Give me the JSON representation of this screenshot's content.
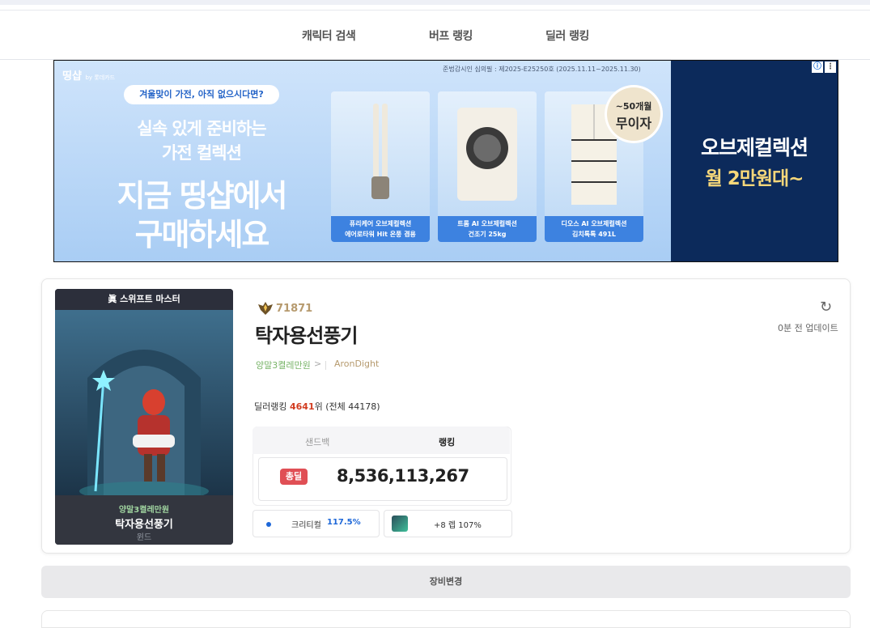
{
  "nav": {
    "items": [
      "캐릭터 검색",
      "버프 랭킹",
      "딜러 랭킹"
    ]
  },
  "ad": {
    "logo": "띵샵",
    "logo_sub": "by 롯데카드",
    "notice": "준법감시인 심의필 : 제2025-E25250호 (2025.11.11~2025.11.30)",
    "pill": "겨울맞이 가전, 아직 없으시다면?",
    "line1": "실속 있게 준비하는",
    "line2": "가전 컬렉션",
    "line3": "지금 띵샵에서",
    "line4": "구매하세요",
    "products": [
      {
        "cap1": "퓨리케어 오브제컬렉션",
        "cap2": "에어로타워 Hit 온풍 겸용"
      },
      {
        "cap1": "트롬 AI 오브제컬렉션",
        "cap2": "건조기 25kg"
      },
      {
        "cap1": "디오스 AI 오브제컬렉션",
        "cap2": "김치톡톡 491L"
      }
    ],
    "badge_top": "~50개월",
    "badge_bottom": "무이자",
    "right_line1": "오브제컬렉션",
    "right_line2": "월 2만원대~",
    "info_icon": "info-icon",
    "menu_icon": "kebab-menu-icon"
  },
  "character": {
    "title_badge": "眞 스위프트 마스터",
    "fame": "71871",
    "name": "탁자용선풍기",
    "guild": "양말3켤레만원",
    "server": "AronDight",
    "portrait_guild": "양말3켤레만원",
    "portrait_name": "탁자용선풍기",
    "portrait_job": "윈드",
    "rank_prefix": "딜러랭킹 ",
    "rank_value": "4641",
    "rank_suffix": "위 (전체 44178)",
    "updated": "0분 전 업데이트",
    "refresh_icon": "refresh-icon",
    "fame_icon": "fame-icon"
  },
  "damage": {
    "tabs": [
      "샌드백",
      "랭킹"
    ],
    "active_tab": "랭킹",
    "tag": "총딜",
    "value": "8,536,113,267"
  },
  "stats": {
    "crit_label": "크리티컬",
    "crit_value": "117.5%",
    "skill_text": "+8 렙 107%"
  },
  "equip_button": "장비변경",
  "colors": {
    "accent_red": "#e04f55",
    "rank_red": "#d23c20",
    "crit_blue": "#1d67d8",
    "guild_green": "#78b468",
    "server_gold": "#b69a6e",
    "ad_navy": "#0c2a5b"
  }
}
